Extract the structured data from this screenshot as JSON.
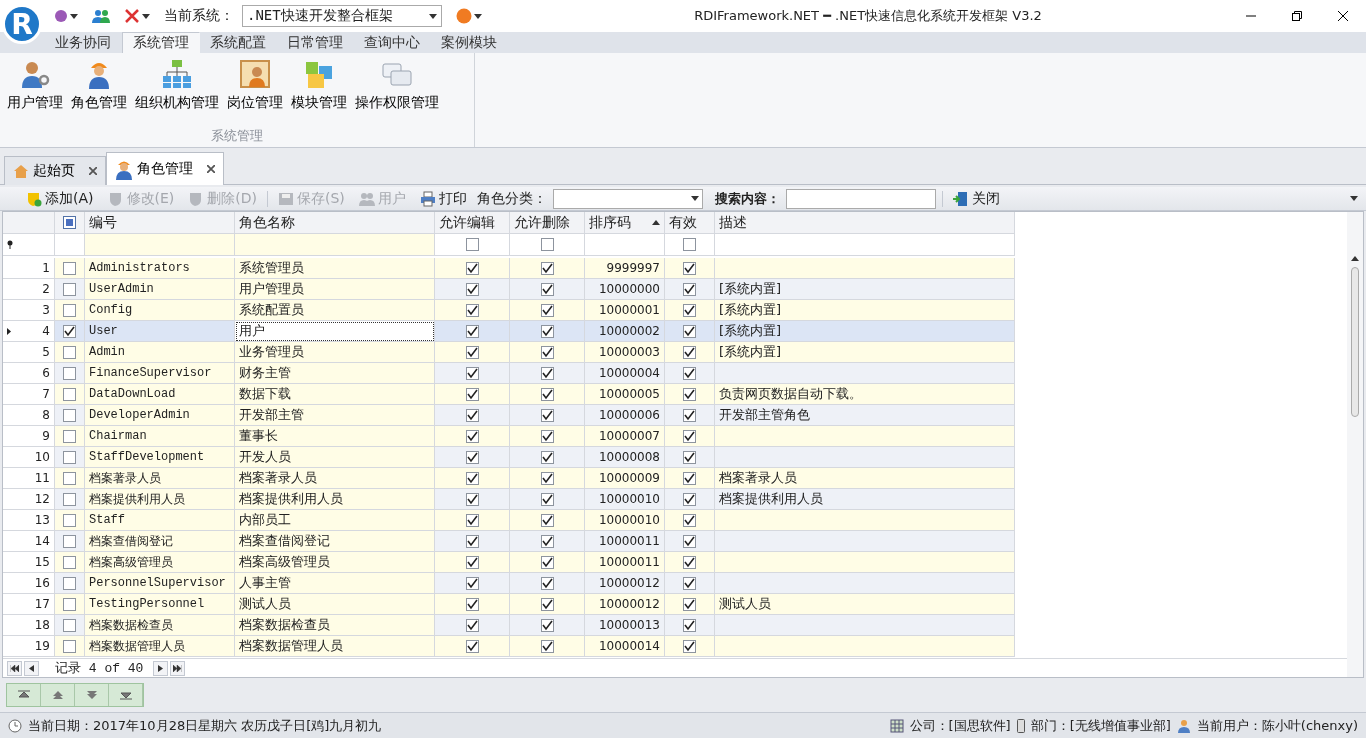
{
  "window": {
    "logo": "R",
    "system_label": "当前系统：",
    "system_value": ".NET快速开发整合框架",
    "title": "RDIFramework.NET ━ .NET快速信息化系统开发框架 V3.2"
  },
  "ribbon_tabs": [
    {
      "label": "业务协同",
      "selected": false
    },
    {
      "label": "系统管理",
      "selected": true
    },
    {
      "label": "系统配置",
      "selected": false
    },
    {
      "label": "日常管理",
      "selected": false
    },
    {
      "label": "查询中心",
      "selected": false
    },
    {
      "label": "案例模块",
      "selected": false
    }
  ],
  "ribbon_group": {
    "title": "系统管理",
    "items": [
      {
        "kind": "user",
        "label": "用户管理"
      },
      {
        "kind": "role",
        "label": "角色管理"
      },
      {
        "kind": "org",
        "label": "组织机构管理"
      },
      {
        "kind": "post",
        "label": "岗位管理"
      },
      {
        "kind": "module",
        "label": "模块管理"
      },
      {
        "kind": "permission",
        "label": "操作权限管理"
      }
    ]
  },
  "doc_tabs": [
    {
      "kind": "home",
      "label": "起始页",
      "selected": false
    },
    {
      "kind": "role",
      "label": "角色管理",
      "selected": true
    }
  ],
  "toolbar": {
    "buttons": [
      {
        "kind": "add",
        "label": "添加(A)",
        "disabled": false
      },
      {
        "kind": "edit",
        "label": "修改(E)",
        "disabled": true
      },
      {
        "kind": "delete",
        "label": "删除(D)",
        "disabled": true
      },
      {
        "kind": "save",
        "label": "保存(S)",
        "disabled": true
      },
      {
        "kind": "users",
        "label": "用户",
        "disabled": true
      },
      {
        "kind": "print",
        "label": "打印",
        "disabled": false
      }
    ],
    "category_label": "角色分类：",
    "search_label": "搜索内容：",
    "close_label": "关闭"
  },
  "table": {
    "select_all": {
      "indeterminate": true
    },
    "filter": {
      "allow_edit": false,
      "allow_delete": false,
      "enabled": false
    },
    "columns": [
      "编号",
      "角色名称",
      "允许编辑",
      "允许删除",
      "排序码",
      "有效",
      "描述"
    ],
    "rows": [
      {
        "no": "1",
        "checked": false,
        "selected": false,
        "code": "Administrators",
        "name": "系统管理员",
        "allow_edit": true,
        "allow_delete": true,
        "sort": "9999997",
        "enabled": true,
        "description": ""
      },
      {
        "no": "2",
        "checked": false,
        "selected": false,
        "code": "UserAdmin",
        "name": "用户管理员",
        "allow_edit": true,
        "allow_delete": true,
        "sort": "10000000",
        "enabled": true,
        "description": "[系统内置]"
      },
      {
        "no": "3",
        "checked": false,
        "selected": false,
        "code": "Config",
        "name": "系统配置员",
        "allow_edit": true,
        "allow_delete": true,
        "sort": "10000001",
        "enabled": true,
        "description": "[系统内置]"
      },
      {
        "no": "4",
        "checked": true,
        "selected": true,
        "code": "User",
        "name": "用户",
        "allow_edit": true,
        "allow_delete": true,
        "sort": "10000002",
        "enabled": true,
        "description": "[系统内置]"
      },
      {
        "no": "5",
        "checked": false,
        "selected": false,
        "code": "Admin",
        "name": "业务管理员",
        "allow_edit": true,
        "allow_delete": true,
        "sort": "10000003",
        "enabled": true,
        "description": "[系统内置]"
      },
      {
        "no": "6",
        "checked": false,
        "selected": false,
        "code": "FinanceSupervisor",
        "name": "财务主管",
        "allow_edit": true,
        "allow_delete": true,
        "sort": "10000004",
        "enabled": true,
        "description": ""
      },
      {
        "no": "7",
        "checked": false,
        "selected": false,
        "code": "DataDownLoad",
        "name": "数据下载",
        "allow_edit": true,
        "allow_delete": true,
        "sort": "10000005",
        "enabled": true,
        "description": "负责网页数据自动下载。"
      },
      {
        "no": "8",
        "checked": false,
        "selected": false,
        "code": "DeveloperAdmin",
        "name": "开发部主管",
        "allow_edit": true,
        "allow_delete": true,
        "sort": "10000006",
        "enabled": true,
        "description": "开发部主管角色"
      },
      {
        "no": "9",
        "checked": false,
        "selected": false,
        "code": "Chairman",
        "name": "董事长",
        "allow_edit": true,
        "allow_delete": true,
        "sort": "10000007",
        "enabled": true,
        "description": ""
      },
      {
        "no": "10",
        "checked": false,
        "selected": false,
        "code": "StaffDevelopment",
        "name": "开发人员",
        "allow_edit": true,
        "allow_delete": true,
        "sort": "10000008",
        "enabled": true,
        "description": ""
      },
      {
        "no": "11",
        "checked": false,
        "selected": false,
        "code": "档案著录人员",
        "name": "档案著录人员",
        "allow_edit": true,
        "allow_delete": true,
        "sort": "10000009",
        "enabled": true,
        "description": "档案著录人员"
      },
      {
        "no": "12",
        "checked": false,
        "selected": false,
        "code": "档案提供利用人员",
        "name": "档案提供利用人员",
        "allow_edit": true,
        "allow_delete": true,
        "sort": "10000010",
        "enabled": true,
        "description": "档案提供利用人员"
      },
      {
        "no": "13",
        "checked": false,
        "selected": false,
        "code": "Staff",
        "name": "内部员工",
        "allow_edit": true,
        "allow_delete": true,
        "sort": "10000010",
        "enabled": true,
        "description": ""
      },
      {
        "no": "14",
        "checked": false,
        "selected": false,
        "code": "档案查借阅登记",
        "name": "档案查借阅登记",
        "allow_edit": true,
        "allow_delete": true,
        "sort": "10000011",
        "enabled": true,
        "description": ""
      },
      {
        "no": "15",
        "checked": false,
        "selected": false,
        "code": "档案高级管理员",
        "name": "档案高级管理员",
        "allow_edit": true,
        "allow_delete": true,
        "sort": "10000011",
        "enabled": true,
        "description": ""
      },
      {
        "no": "16",
        "checked": false,
        "selected": false,
        "code": "PersonnelSupervisor",
        "name": "人事主管",
        "allow_edit": true,
        "allow_delete": true,
        "sort": "10000012",
        "enabled": true,
        "description": ""
      },
      {
        "no": "17",
        "checked": false,
        "selected": false,
        "code": "TestingPersonnel",
        "name": "测试人员",
        "allow_edit": true,
        "allow_delete": true,
        "sort": "10000012",
        "enabled": true,
        "description": "测试人员"
      },
      {
        "no": "18",
        "checked": false,
        "selected": false,
        "code": "档案数据检查员",
        "name": "档案数据检查员",
        "allow_edit": true,
        "allow_delete": true,
        "sort": "10000013",
        "enabled": true,
        "description": ""
      },
      {
        "no": "19",
        "checked": false,
        "selected": false,
        "code": "档案数据管理人员",
        "name": "档案数据管理人员",
        "allow_edit": true,
        "allow_delete": true,
        "sort": "10000014",
        "enabled": true,
        "description": ""
      }
    ]
  },
  "navigator": {
    "label": "记录",
    "position": "4 of 40"
  },
  "status_bar": {
    "date": "当前日期：2017年10月28日星期六 农历戊子日[鸡]九月初九",
    "company": "公司：[国思软件]",
    "department": "部门：[无线增值事业部]",
    "user": "当前用户：陈小叶(chenxy)"
  }
}
